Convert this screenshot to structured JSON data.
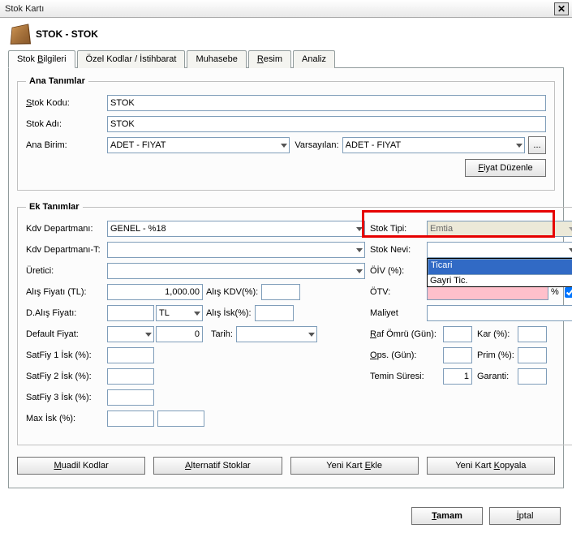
{
  "window": {
    "title": "Stok Kartı"
  },
  "header": {
    "title": "STOK - STOK"
  },
  "tabs": [
    {
      "label": "Stok Bilgileri",
      "u": "B"
    },
    {
      "label": "Özel Kodlar / İstihbarat"
    },
    {
      "label": "Muhasebe"
    },
    {
      "label": "Resim",
      "u": "R"
    },
    {
      "label": "Analiz"
    }
  ],
  "ana": {
    "legend": "Ana Tanımlar",
    "stok_kodu_lbl": "Stok Kodu:",
    "stok_kodu": "STOK",
    "stok_adi_lbl": "Stok Adı:",
    "stok_adi": "STOK",
    "ana_birim_lbl": "Ana Birim:",
    "ana_birim": "ADET - FIYAT",
    "varsayilan_lbl": "Varsayılan:",
    "varsayilan": "ADET - FIYAT",
    "fiyat_duzenle": "Fiyat Düzenle",
    "ellipsis": "..."
  },
  "ek": {
    "legend": "Ek Tanımlar",
    "kdv_dept_lbl": "Kdv Departmanı:",
    "kdv_dept": "GENEL - %18",
    "kdv_dept_t_lbl": "Kdv Departmanı-T:",
    "kdv_dept_t": "",
    "uretici_lbl": "Üretici:",
    "uretici": "",
    "alis_fiyati_lbl": "Alış Fiyatı (TL):",
    "alis_fiyati": "1,000.00",
    "alis_kdv_lbl": "Alış KDV(%):",
    "alis_kdv": "",
    "dalis_lbl": "D.Alış Fiyatı:",
    "dalis": "",
    "currency": "TL",
    "alis_isk_lbl": "Alış İsk(%):",
    "alis_isk": "",
    "default_fiyat_lbl": "Default Fiyat:",
    "default_fiyat_sel": "",
    "default_fiyat_val": "0",
    "tarih_lbl": "Tarih:",
    "tarih": "",
    "sf1_lbl": "SatFiy 1 İsk (%):",
    "sf2_lbl": "SatFiy 2 İsk (%):",
    "sf3_lbl": "SatFiy 3 İsk (%):",
    "max_isk_lbl": "Max İsk (%):",
    "stok_tipi_lbl": "Stok Tipi:",
    "stok_tipi": "Emtia",
    "stok_nevi_lbl": "Stok Nevi:",
    "stok_nevi": "",
    "nevi_options": [
      "Ticari",
      "Gayri Tic."
    ],
    "oiv_lbl": "ÖİV (%):",
    "otv_lbl": "ÖTV:",
    "otv_unit": "%",
    "maliyet_lbl": "Maliyet",
    "raf_lbl": "Raf Ömrü (Gün):",
    "kar_lbl": "Kar (%):",
    "ops_lbl": "Ops. (Gün):",
    "prim_lbl": "Prim (%):",
    "temin_lbl": "Temin Süresi:",
    "temin": "1",
    "garanti_lbl": "Garanti:"
  },
  "bottom_buttons": {
    "muadil": "Muadil Kodlar",
    "alternatif": "Alternatif Stoklar",
    "yeni_ekle": "Yeni Kart Ekle",
    "yeni_kopyala": "Yeni Kart Kopyala"
  },
  "footer": {
    "tamam": "Tamam",
    "iptal": "İptal"
  }
}
